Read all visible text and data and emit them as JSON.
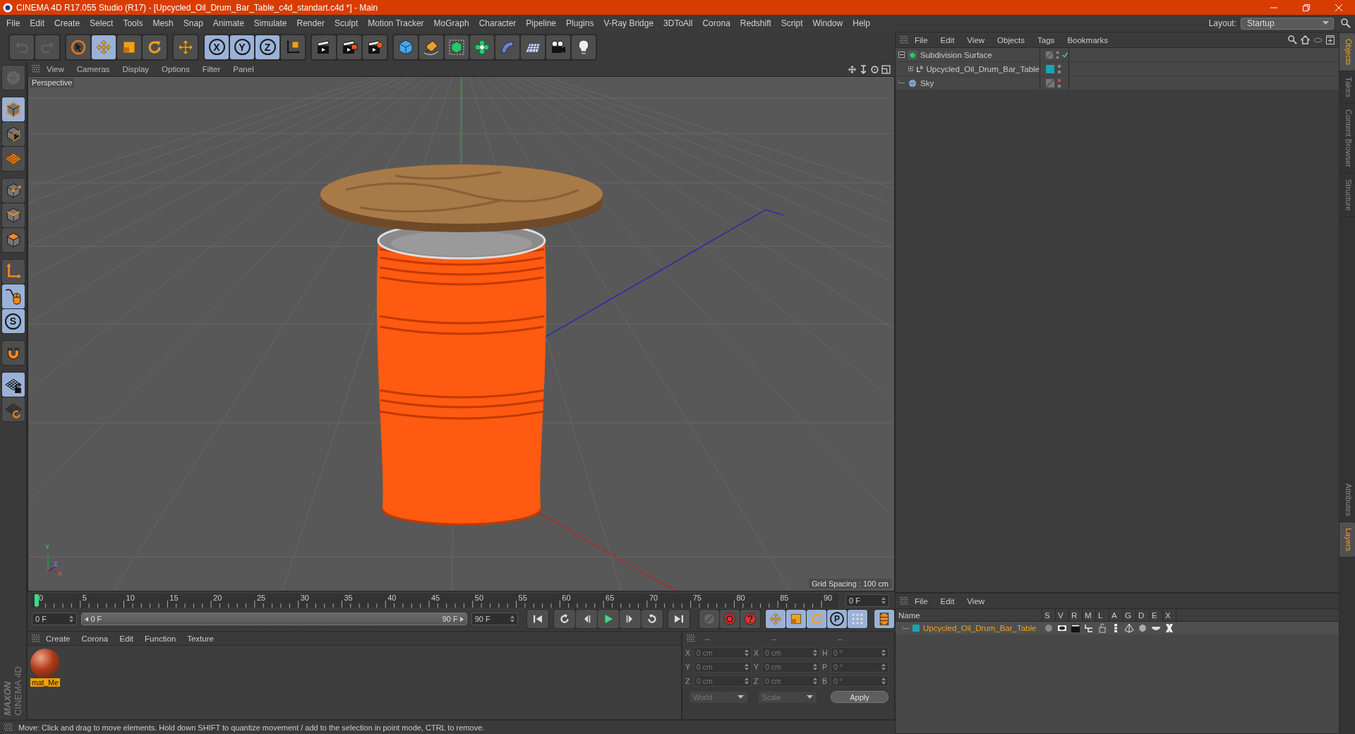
{
  "window": {
    "title": "CINEMA 4D R17.055 Studio (R17) - [Upcycled_Oil_Drum_Bar_Table_c4d_standart.c4d *] - Main"
  },
  "menu": [
    "File",
    "Edit",
    "Create",
    "Select",
    "Tools",
    "Mesh",
    "Snap",
    "Animate",
    "Simulate",
    "Render",
    "Sculpt",
    "Motion Tracker",
    "MoGraph",
    "Character",
    "Pipeline",
    "Plugins",
    "V-Ray Bridge",
    "3DToAll",
    "Corona",
    "Redshift",
    "Script",
    "Window",
    "Help"
  ],
  "layout": {
    "label": "Layout:",
    "value": "Startup"
  },
  "toolbar": [
    [
      {
        "kind": "undo",
        "on": false,
        "disabled": true
      },
      {
        "kind": "redo",
        "on": false,
        "disabled": true
      }
    ],
    [
      {
        "kind": "live-select",
        "on": false,
        "disabled": false
      },
      {
        "kind": "move",
        "on": true,
        "disabled": false
      },
      {
        "kind": "scale",
        "on": false,
        "disabled": false
      },
      {
        "kind": "rotate",
        "on": false,
        "disabled": false
      }
    ],
    [
      {
        "kind": "last-tool",
        "on": false,
        "disabled": false
      }
    ],
    [
      {
        "kind": "axis",
        "label": "X",
        "on": true,
        "disabled": false
      },
      {
        "kind": "axis",
        "label": "Y",
        "on": true,
        "disabled": false
      },
      {
        "kind": "axis",
        "label": "Z",
        "on": true,
        "disabled": false
      },
      {
        "kind": "coords",
        "on": false,
        "disabled": false
      }
    ],
    [
      {
        "kind": "render-view",
        "on": false,
        "disabled": false
      },
      {
        "kind": "render-picture",
        "on": false,
        "disabled": false
      },
      {
        "kind": "render-settings",
        "on": false,
        "disabled": false
      }
    ],
    [
      {
        "kind": "cube",
        "on": false,
        "disabled": false
      },
      {
        "kind": "pen",
        "on": false,
        "disabled": false
      },
      {
        "kind": "subdivision",
        "on": false,
        "disabled": false
      },
      {
        "kind": "cloner",
        "on": false,
        "disabled": false
      },
      {
        "kind": "deformer",
        "on": false,
        "disabled": false
      },
      {
        "kind": "floor",
        "on": false,
        "disabled": false
      },
      {
        "kind": "camera",
        "on": false,
        "disabled": false
      },
      {
        "kind": "light",
        "on": false,
        "disabled": false
      }
    ]
  ],
  "side_tools": [
    [
      {
        "kind": "make-editable",
        "on": false,
        "disabled": true
      }
    ],
    [
      {
        "kind": "model",
        "on": true,
        "disabled": false
      },
      {
        "kind": "texture",
        "on": false,
        "disabled": false
      },
      {
        "kind": "workplane",
        "on": false,
        "disabled": false
      }
    ],
    [
      {
        "kind": "points",
        "on": false,
        "disabled": false
      },
      {
        "kind": "edges",
        "on": false,
        "disabled": false
      },
      {
        "kind": "polygons",
        "on": false,
        "disabled": false
      }
    ],
    [
      {
        "kind": "axis-mode",
        "on": false,
        "disabled": false
      },
      {
        "kind": "tweak",
        "on": true,
        "disabled": false
      },
      {
        "kind": "snap",
        "label": "S",
        "on": true,
        "disabled": false
      }
    ],
    [
      {
        "kind": "magnet",
        "on": false,
        "disabled": false
      }
    ],
    [
      {
        "kind": "lock-grid",
        "on": true,
        "disabled": false
      },
      {
        "kind": "grid-rotate",
        "on": false,
        "disabled": false
      }
    ]
  ],
  "logo": [
    "MAXON",
    "CINEMA 4D"
  ],
  "viewport": {
    "menu": [
      "View",
      "Cameras",
      "Display",
      "Options",
      "Filter",
      "Panel"
    ],
    "camera": "Perspective",
    "grid_spacing": "Grid Spacing : 100 cm",
    "axis_gizmo": [
      "Y",
      "Z",
      "X"
    ]
  },
  "timeline": {
    "frames": [
      "0",
      "5",
      "10",
      "15",
      "20",
      "25",
      "30",
      "35",
      "40",
      "45",
      "50",
      "55",
      "60",
      "65",
      "70",
      "75",
      "80",
      "85",
      "90"
    ],
    "level": 0,
    "current": "0 F",
    "start": "0 F",
    "range": {
      "start": "0 F",
      "end": "90 F",
      "level": 1
    },
    "end": "90 F",
    "keys": [
      {
        "kind": "motion",
        "on": false
      },
      {
        "kind": "record",
        "on": false
      },
      {
        "kind": "autokey",
        "on": false
      },
      {
        "kind": "key-move",
        "on": true
      },
      {
        "kind": "key-scale",
        "on": true
      },
      {
        "kind": "key-rotate",
        "on": true
      },
      {
        "kind": "key-param",
        "label": "P",
        "on": true
      },
      {
        "kind": "key-pla",
        "on": true
      },
      {
        "kind": "timeline",
        "on": true
      }
    ]
  },
  "materials": {
    "menu": [
      "Create",
      "Corona",
      "Edit",
      "Function",
      "Texture"
    ],
    "items": [
      {
        "name": "mat_Me",
        "selected": true
      }
    ]
  },
  "coordinates": {
    "headers": [
      "--",
      "--",
      "--"
    ],
    "rows": [
      {
        "axis": "X",
        "position": "0 cm",
        "size_axis": "X",
        "size": "0 cm",
        "rot_axis": "H",
        "rotation": "0 °"
      },
      {
        "axis": "Y",
        "position": "0 cm",
        "size_axis": "Y",
        "size": "0 cm",
        "rot_axis": "P",
        "rotation": "0 °"
      },
      {
        "axis": "Z",
        "position": "0 cm",
        "size_axis": "Z",
        "size": "0 cm",
        "rot_axis": "B",
        "rotation": "0 °"
      }
    ],
    "mode": "World",
    "size_mode": "Scale",
    "apply": "Apply"
  },
  "objects": {
    "menu": [
      "File",
      "Edit",
      "View",
      "Objects",
      "Tags",
      "Bookmarks"
    ],
    "tree": [
      {
        "name": "Subdivision Surface",
        "kind": "subdivision",
        "expanded": true,
        "editor_hidden": false,
        "enabled": true,
        "children": [
          {
            "name": "Upcycled_Oil_Drum_Bar_Table",
            "kind": "null",
            "expanded": false,
            "editor_hidden": false,
            "enabled": false,
            "color": "#1aa3b0"
          }
        ]
      },
      {
        "name": "Sky",
        "kind": "sky",
        "editor_hidden": true,
        "enabled": false
      }
    ]
  },
  "layers": {
    "menu": [
      "File",
      "Edit",
      "View"
    ],
    "columns": [
      "Name",
      "S",
      "V",
      "R",
      "M",
      "L",
      "A",
      "G",
      "D",
      "E",
      "X"
    ],
    "rows": [
      {
        "name": "Upcycled_Oil_Drum_Bar_Table",
        "color": "#1aa3b0"
      }
    ]
  },
  "side_tabs": {
    "top": [
      {
        "label": "Objects",
        "selected": true
      },
      {
        "label": "Takes",
        "selected": false
      },
      {
        "label": "Content Browser",
        "selected": false
      },
      {
        "label": "Structure",
        "selected": false
      }
    ],
    "bottom": [
      {
        "label": "Attributes",
        "selected": false
      },
      {
        "label": "Layers",
        "selected": true
      }
    ]
  },
  "status": "Move: Click and drag to move elements. Hold down SHIFT to quantize movement / add to the selection in point mode, CTRL to remove."
}
